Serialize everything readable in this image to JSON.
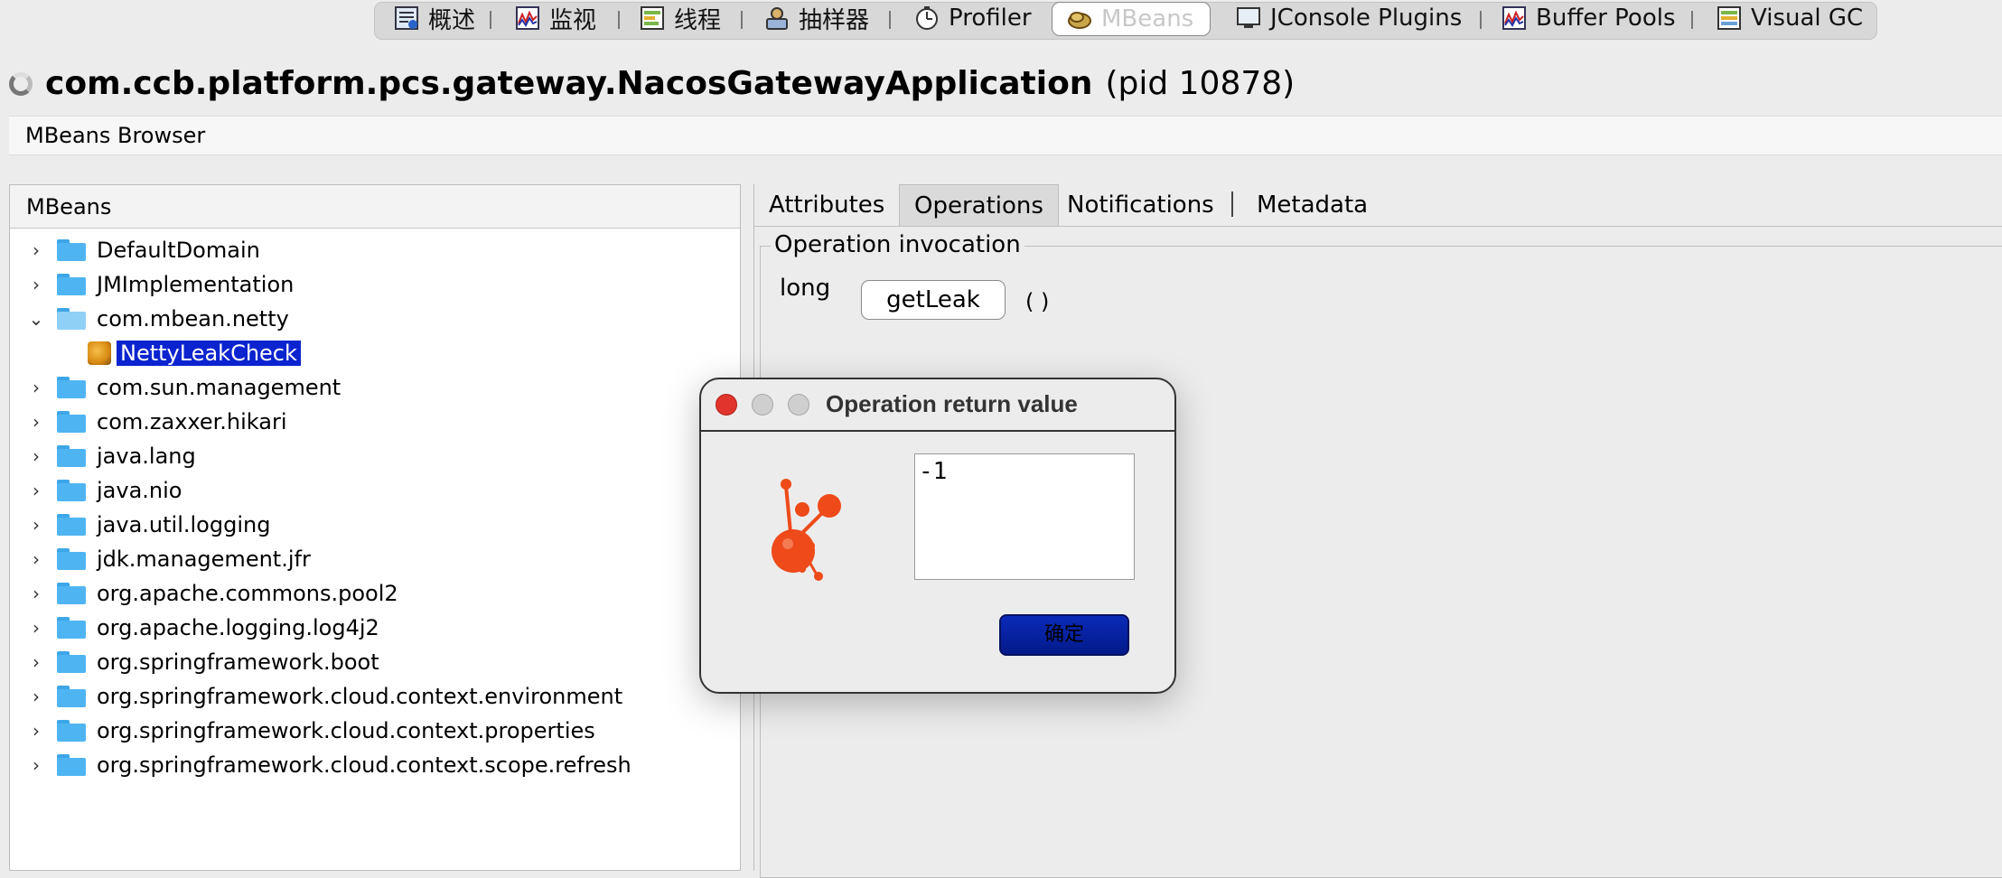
{
  "tabs": [
    {
      "label": "概述",
      "icon": "overview-icon"
    },
    {
      "label": "监视",
      "icon": "monitor-icon"
    },
    {
      "label": "线程",
      "icon": "threads-icon"
    },
    {
      "label": "抽样器",
      "icon": "sampler-icon"
    },
    {
      "label": "Profiler",
      "icon": "profiler-icon"
    },
    {
      "label": "MBeans",
      "icon": "mbeans-icon",
      "active": true
    },
    {
      "label": "JConsole Plugins",
      "icon": "jconsole-plugins-icon"
    },
    {
      "label": "Buffer Pools",
      "icon": "buffer-pools-icon"
    },
    {
      "label": "Visual GC",
      "icon": "visual-gc-icon"
    }
  ],
  "header": {
    "app": "com.ccb.platform.pcs.gateway.NacosGatewayApplication",
    "pid": "(pid 10878)"
  },
  "browser_title": "MBeans Browser",
  "tree": {
    "title": "MBeans",
    "items": [
      {
        "label": "DefaultDomain",
        "expanded": false
      },
      {
        "label": "JMImplementation",
        "expanded": false
      },
      {
        "label": "com.mbean.netty",
        "expanded": true
      },
      {
        "label": "NettyLeakCheck",
        "child": true,
        "selected": true
      },
      {
        "label": "com.sun.management",
        "expanded": false
      },
      {
        "label": "com.zaxxer.hikari",
        "expanded": false
      },
      {
        "label": "java.lang",
        "expanded": false
      },
      {
        "label": "java.nio",
        "expanded": false
      },
      {
        "label": "java.util.logging",
        "expanded": false
      },
      {
        "label": "jdk.management.jfr",
        "expanded": false
      },
      {
        "label": "org.apache.commons.pool2",
        "expanded": false
      },
      {
        "label": "org.apache.logging.log4j2",
        "expanded": false
      },
      {
        "label": "org.springframework.boot",
        "expanded": false
      },
      {
        "label": "org.springframework.cloud.context.environment",
        "expanded": false
      },
      {
        "label": "org.springframework.cloud.context.properties",
        "expanded": false
      },
      {
        "label": "org.springframework.cloud.context.scope.refresh",
        "expanded": false
      }
    ]
  },
  "detail_tabs": [
    "Attributes",
    "Operations",
    "Notifications",
    "Metadata"
  ],
  "operations": {
    "group_title": "Operation invocation",
    "return_type": "long",
    "name": "getLeak",
    "params": "( )"
  },
  "dialog": {
    "title": "Operation return value",
    "value": "-1",
    "ok_label": "确定"
  }
}
